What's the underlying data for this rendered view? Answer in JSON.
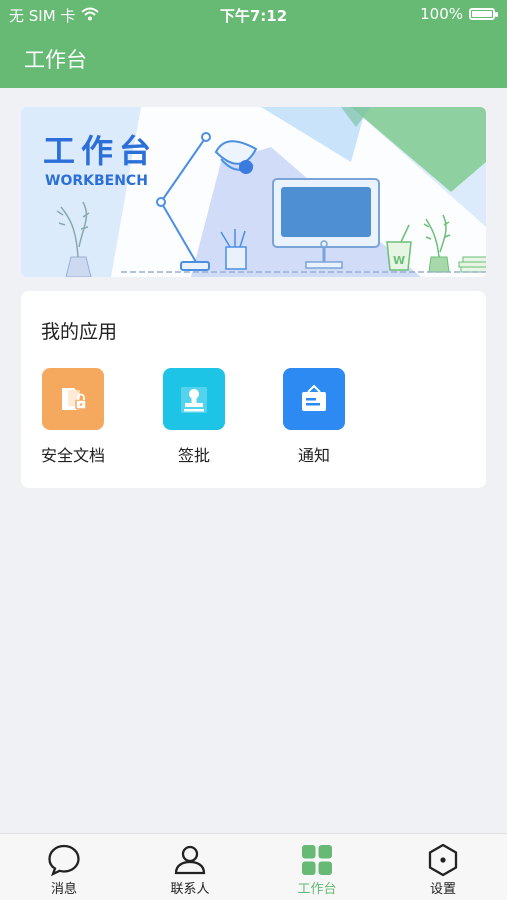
{
  "status_bar": {
    "carrier": "无 SIM 卡",
    "time": "下午7:12",
    "battery": "100%"
  },
  "header": {
    "title": "工作台"
  },
  "banner": {
    "title": "工作台",
    "subtitle": "WORKBENCH",
    "cup_letter": "W"
  },
  "my_apps": {
    "heading": "我的应用",
    "items": [
      {
        "label": "安全文档",
        "icon": "secure-document-icon",
        "color": "#f5a95f"
      },
      {
        "label": "签批",
        "icon": "stamp-icon",
        "color": "#1ec4e6"
      },
      {
        "label": "通知",
        "icon": "notice-board-icon",
        "color": "#2c8af2"
      }
    ]
  },
  "tabbar": {
    "items": [
      {
        "label": "消息",
        "icon": "chat-bubble-icon"
      },
      {
        "label": "联系人",
        "icon": "person-icon"
      },
      {
        "label": "工作台",
        "icon": "grid-icon",
        "active": true
      },
      {
        "label": "设置",
        "icon": "hexagon-settings-icon"
      }
    ],
    "active_color": "#66ba73"
  },
  "colors": {
    "header": "#66ba73",
    "background": "#eff1f5"
  }
}
